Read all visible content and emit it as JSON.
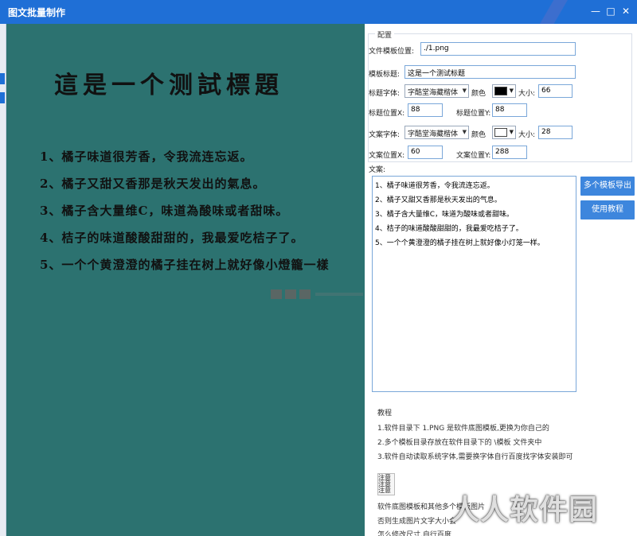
{
  "window": {
    "title": "图文批量制作"
  },
  "preview": {
    "title": "這是一个测試標題",
    "lines": [
      "1、橘子味道很芳香，令我流连忘返。",
      "2、橘子又甜又香那是秋天发出的氣息。",
      "3、橘子含大量维C，味道為酸味或者甜味。",
      "4、桔子的味道酸酸甜甜的，我最爱吃桔子了。",
      "5、一个个黄澄澄的橘子挂在树上就好像小燈籠一樣"
    ]
  },
  "config": {
    "legend": "配置",
    "template_path_label": "文件模板位置:",
    "template_path_value": "./1.png",
    "template_title_label": "模板标题:",
    "template_title_value": "这是一个测试标题",
    "title_font_label": "标题字体:",
    "title_font_value": "字酷堂海藏楷体",
    "title_color_label": "颜色",
    "title_color": "#000000",
    "title_size_label": "大小:",
    "title_size_value": "66",
    "title_x_label": "标题位置X:",
    "title_x_value": "88",
    "title_y_label": "标题位置Y:",
    "title_y_value": "88",
    "body_font_label": "文案字体:",
    "body_font_value": "字酷堂海藏楷体",
    "body_color_label": "颜色",
    "body_color": "#ffffff",
    "body_size_label": "大小:",
    "body_size_value": "28",
    "body_x_label": "文案位置X:",
    "body_x_value": "60",
    "body_y_label": "文案位置Y:",
    "body_y_value": "288"
  },
  "content": {
    "label": "文案:",
    "lines": [
      "1、橘子味道很芳香，令我流连忘返。",
      "2、橘子又甜又香那是秋天发出的气息。",
      "3、橘子含大量维C，味道为酸味或者甜味。",
      "4、桔子的味道酸酸甜甜的，我最爱吃桔子了。",
      "5、一个个黄澄澄的橘子挂在树上就好像小灯笼一样。"
    ]
  },
  "buttons": {
    "export_label": "多个模板导出",
    "help_label": "使用教程"
  },
  "tutorial": {
    "heading": "教程",
    "lines": [
      "1.软件目录下 1.PNG 是软件底图模板,更换为你自己的",
      "2.多个模板目录存放在软件目录下的 \\模板 文件夹中",
      "3.软件自动读取系统字体,需要换字体自行百度找字体安装即可"
    ]
  },
  "notes": {
    "label": "注意",
    "lines": [
      "软件底图模板和其他多个模板图片",
      "否则生成图片文字大小会",
      "怎么修改尺寸,自行百度"
    ]
  },
  "watermark": {
    "text": "人人软件园"
  }
}
